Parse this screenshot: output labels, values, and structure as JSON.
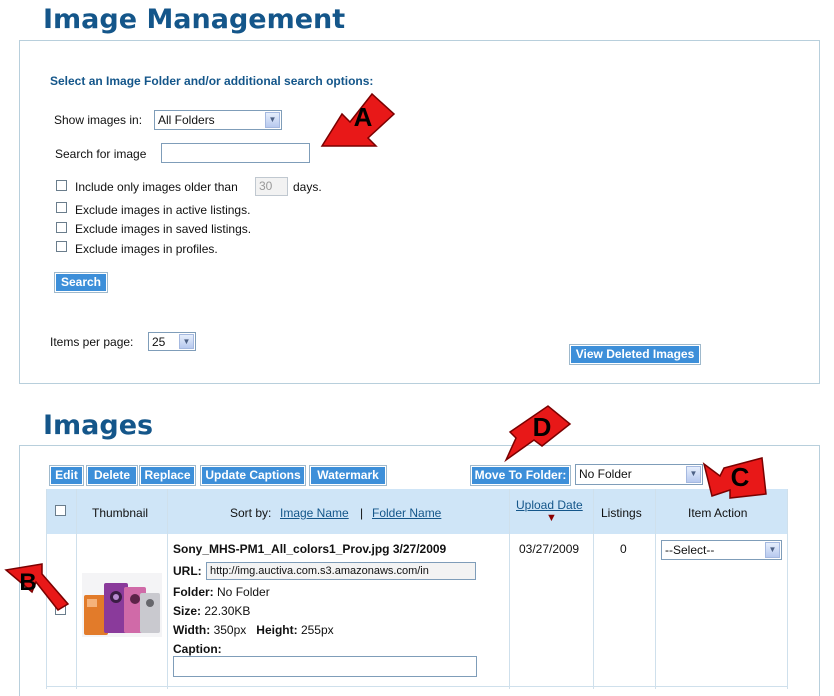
{
  "header": {
    "title": "Image Management"
  },
  "search": {
    "heading": "Select an Image Folder and/or additional search options:",
    "show_label": "Show images in:",
    "show_value": "All Folders",
    "search_label": "Search for image",
    "search_value": "",
    "older_label": "Include only images older than",
    "older_value": "30",
    "older_unit": "days.",
    "exclude_active": "Exclude images in active listings.",
    "exclude_saved": "Exclude images in saved listings.",
    "exclude_profiles": "Exclude images in profiles.",
    "search_button": "Search",
    "items_label": "Items per page:",
    "items_value": "25",
    "view_deleted": "View Deleted Images"
  },
  "images": {
    "title": "Images",
    "toolbar": [
      "Edit",
      "Delete",
      "Replace",
      "Update Captions",
      "Watermark"
    ],
    "move_button": "Move To Folder:",
    "folder_value": "No Folder",
    "columns": {
      "thumbnail": "Thumbnail",
      "sort_by": "Sort by:",
      "image_name": "Image Name",
      "separator": "|",
      "folder_name": "Folder Name",
      "upload_date": "Upload Date",
      "sort_arrow": "▼",
      "listings": "Listings",
      "item_action": "Item Action"
    },
    "row": {
      "name": "Sony_MHS-PM1_All_colors1_Prov.jpg 3/27/2009",
      "url_label": "URL:",
      "url_value": "http://img.auctiva.com.s3.amazonaws.com/in",
      "folder_label": "Folder:",
      "folder_value": "No Folder",
      "size_label": "Size:",
      "size_value": "22.30KB",
      "width_label": "Width:",
      "width_value": "350px",
      "height_label": "Height:",
      "height_value": "255px",
      "caption_label": "Caption:",
      "upload_date": "03/27/2009",
      "listings": "0",
      "action_value": "--Select--"
    }
  },
  "annotations": {
    "a": "A",
    "b": "B",
    "c": "C",
    "d": "D",
    "color": "#e81818"
  },
  "colors": {
    "title": "#14568a",
    "button": "#3d8fd9",
    "table_header": "#cfe5f7"
  }
}
